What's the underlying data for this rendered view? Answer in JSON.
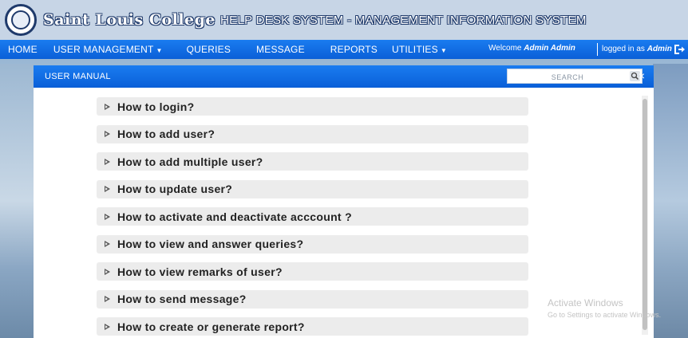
{
  "header": {
    "college_name": "Saint Louis College",
    "system_title": "HELP DESK SYSTEM - MANAGEMENT INFORMATION SYSTEM"
  },
  "nav": {
    "items": [
      {
        "label": "HOME",
        "dropdown": false
      },
      {
        "label": "USER MANAGEMENT",
        "dropdown": true
      },
      {
        "label": "QUERIES",
        "dropdown": false
      },
      {
        "label": "MESSAGE",
        "dropdown": false
      },
      {
        "label": "REPORTS",
        "dropdown": false
      },
      {
        "label": "UTILITIES",
        "dropdown": true
      }
    ],
    "welcome_prefix": "Welcome",
    "welcome_user": "Admin Admin",
    "logged_prefix": "logged in as",
    "logged_user": "Admin"
  },
  "modal": {
    "title": "USER MANUAL",
    "search_placeholder": "SEARCH",
    "close_label": "×",
    "faq": [
      "How to login?",
      "How to add user?",
      "How to add multiple user?",
      "How to update user?",
      "How to activate and deactivate acccount ?",
      "How to view and answer queries?",
      "How to view remarks of user?",
      "How to send message?",
      "How to create or generate report?"
    ]
  },
  "watermark": {
    "title": "Activate Windows",
    "subtitle": "Go to Settings to activate Windows."
  },
  "colors": {
    "nav_blue": "#0a5fd8",
    "header_bg": "#c7d5e6",
    "faq_bg": "#ececec"
  },
  "icons": {
    "logo": "college-seal-icon",
    "logout": "logout-icon",
    "search": "search-icon",
    "faq_arrow": "play-triangle-icon"
  }
}
